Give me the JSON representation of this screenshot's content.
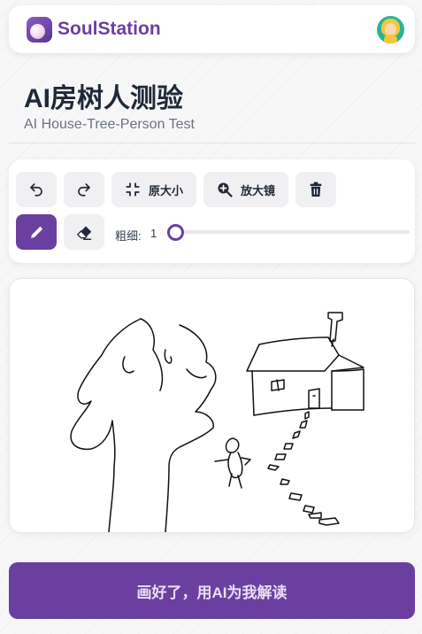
{
  "header": {
    "app_name": "SoulStation",
    "logo_icon": "soulstation-logo-icon",
    "avatar_icon": "user-avatar-icon"
  },
  "page": {
    "title": "AI房树人测验",
    "subtitle": "AI House-Tree-Person Test"
  },
  "toolbar": {
    "undo_icon": "undo-icon",
    "redo_icon": "redo-icon",
    "original_size_label": "原大小",
    "magnifier_label": "放大镜",
    "delete_icon": "trash-icon",
    "pen_icon": "pencil-icon",
    "eraser_icon": "eraser-icon",
    "stroke_width_label": "粗细:",
    "stroke_width_value": "1",
    "stroke_width_level": 1
  },
  "canvas": {
    "drawing": "house-tree-person sketch"
  },
  "submit_label": "画好了，用AI为我解读",
  "colors": {
    "accent": "#6b3fa0",
    "button_bg": "#f0f0f2",
    "avatar_bg": "#2bb39a"
  }
}
